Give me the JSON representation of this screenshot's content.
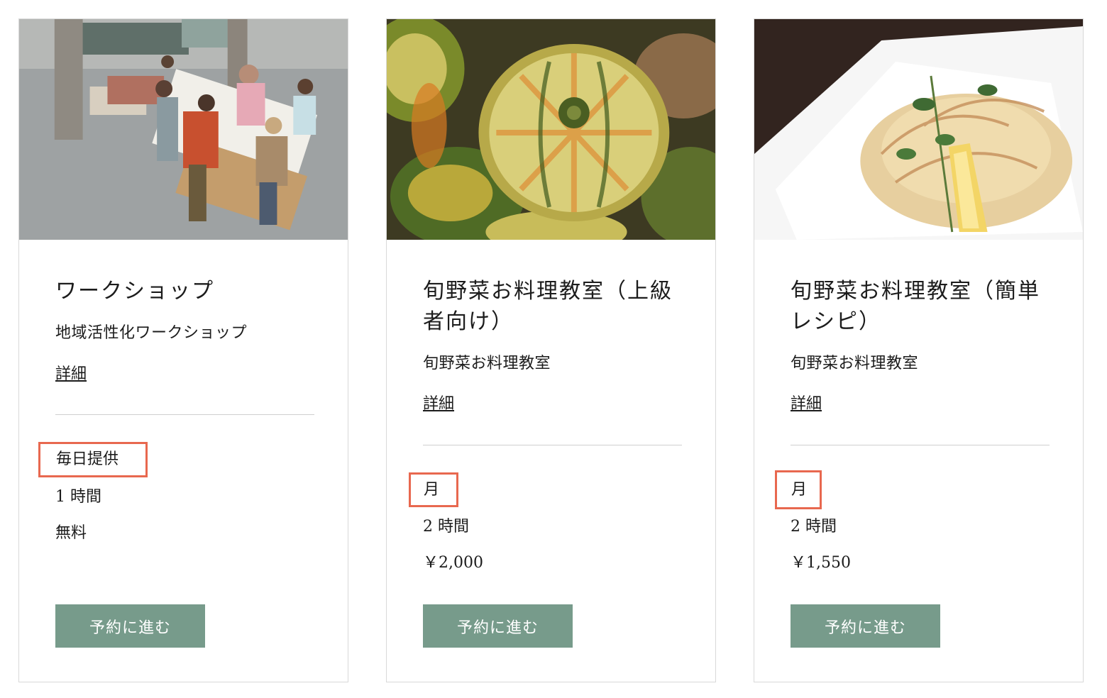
{
  "cards": [
    {
      "image": "workshop-meeting-photo",
      "title": "ワークショップ",
      "subtitle": "地域活性化ワークショップ",
      "details": "詳細",
      "availability": "毎日提供",
      "duration": "1 時間",
      "price": "無料",
      "button": "予約に進む"
    },
    {
      "image": "squash-pumpkin-photo",
      "title": "旬野菜お料理教室（上級者向け）",
      "subtitle": "旬野菜お料理教室",
      "details": "詳細",
      "availability": "月",
      "duration": "2 時間",
      "price": "￥2,000",
      "button": "予約に進む"
    },
    {
      "image": "tempura-dish-photo",
      "title": "旬野菜お料理教室（簡単レシピ）",
      "subtitle": "旬野菜お料理教室",
      "details": "詳細",
      "availability": "月",
      "duration": "2 時間",
      "price": "￥1,550",
      "button": "予約に進む"
    }
  ],
  "colors": {
    "button_bg": "#779b8b",
    "highlight_border": "#e8684f",
    "divider": "#cfcfcf"
  }
}
